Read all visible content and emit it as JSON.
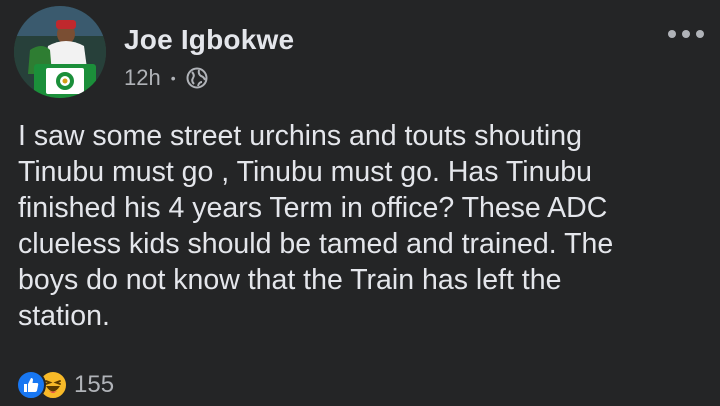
{
  "post": {
    "author": "Joe Igbokwe",
    "time": "12h",
    "separator": "•",
    "privacy_icon": "globe-icon",
    "text": "I saw some street urchins and touts shouting\nTinubu must go , Tinubu must go. Has Tinubu\nfinished his 4 years Term in office? These ADC\nclueless kids should be tamed and trained. The\nboys do not know that the Train has left the\nstation.",
    "reactions": {
      "types": [
        "like-icon",
        "haha-icon"
      ],
      "count": "155"
    }
  },
  "colors": {
    "background": "#242526",
    "text_primary": "#e4e6eb",
    "text_secondary": "#b0b3b8",
    "like_blue": "#1877f2",
    "haha_yellow": "#f7b928"
  }
}
